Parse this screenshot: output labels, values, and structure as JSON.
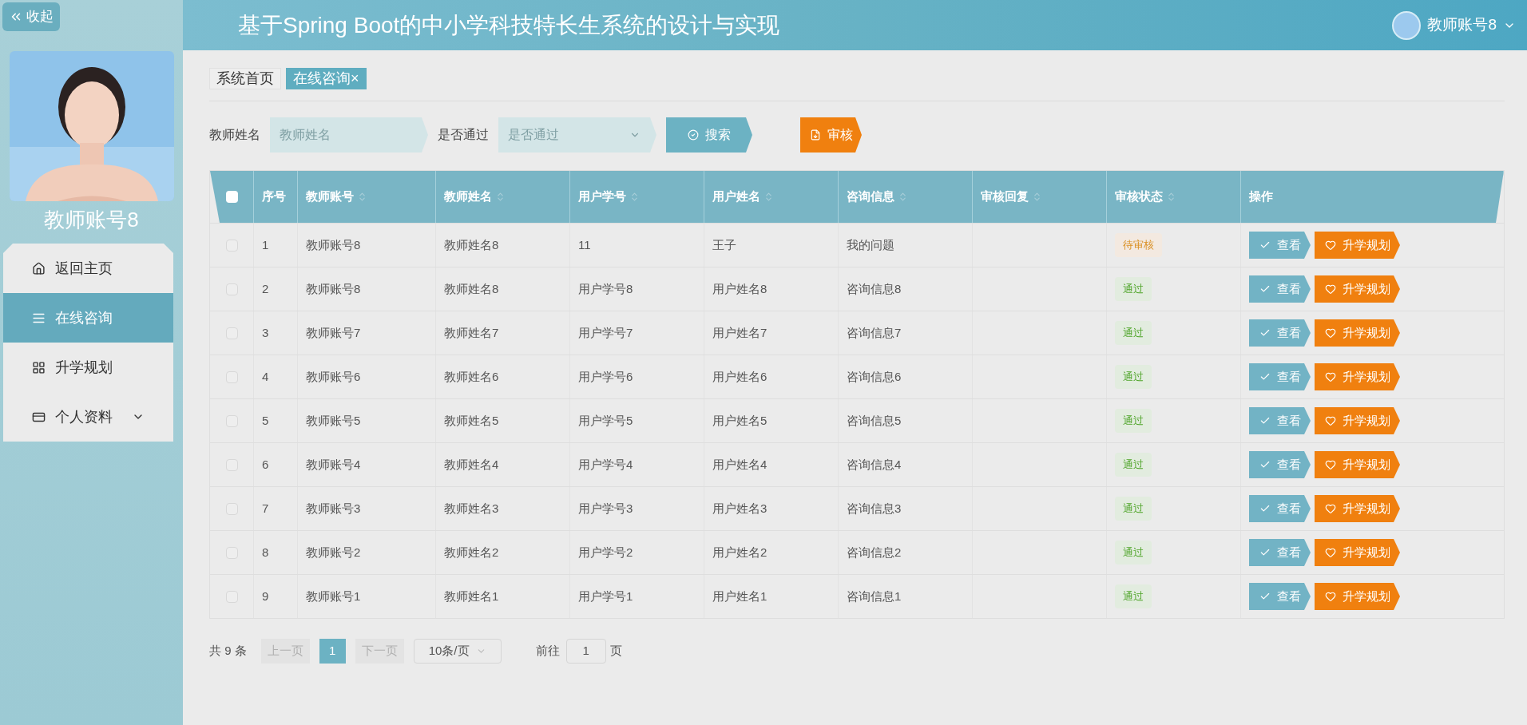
{
  "sidebar": {
    "collapse_button": "收起",
    "profile_name": "教师账号8",
    "items": [
      {
        "label": "返回主页",
        "selected": false,
        "kind": "link"
      },
      {
        "label": "在线咨询",
        "selected": true,
        "kind": "link"
      },
      {
        "label": "升学规划",
        "selected": false,
        "kind": "link"
      },
      {
        "label": "个人资料",
        "selected": false,
        "kind": "submenu"
      }
    ]
  },
  "header": {
    "title": "基于Spring Boot的中小学科技特长生系统的设计与实现",
    "user": "教师账号8"
  },
  "tabs": [
    {
      "label": "系统首页",
      "selected": false
    },
    {
      "label": "在线咨询",
      "selected": true,
      "close": "×"
    }
  ],
  "filters": {
    "fields": [
      {
        "label": "教师姓名",
        "placeholder": "教师姓名",
        "kind": "text"
      },
      {
        "label": "是否通过",
        "placeholder": "是否通过",
        "kind": "select"
      }
    ],
    "search_button": "搜索",
    "review_button": "审核"
  },
  "table": {
    "header_checked": false,
    "columns": [
      {
        "label": "序号",
        "kind": "plain"
      },
      {
        "label": "教师账号",
        "kind": "sortable"
      },
      {
        "label": "教师姓名",
        "kind": "sortable"
      },
      {
        "label": "用户学号",
        "kind": "sortable"
      },
      {
        "label": "用户姓名",
        "kind": "sortable"
      },
      {
        "label": "咨询信息",
        "kind": "sortable"
      },
      {
        "label": "审核回复",
        "kind": "sortable"
      },
      {
        "label": "审核状态",
        "kind": "sortable"
      },
      {
        "label": "操作",
        "kind": "plain"
      }
    ],
    "rows": [
      {
        "checked": false,
        "cells": [
          "1",
          "教师账号8",
          "教师姓名8",
          "11",
          "王子",
          "我的问题"
        ],
        "status": "待审核",
        "pending": true,
        "actions": [
          "查看",
          "升学规划"
        ]
      },
      {
        "checked": false,
        "cells": [
          "2",
          "教师账号8",
          "教师姓名8",
          "用户学号8",
          "用户姓名8",
          "咨询信息8"
        ],
        "status": "通过",
        "pending": false,
        "actions": [
          "查看",
          "升学规划"
        ]
      },
      {
        "checked": false,
        "cells": [
          "3",
          "教师账号7",
          "教师姓名7",
          "用户学号7",
          "用户姓名7",
          "咨询信息7"
        ],
        "status": "通过",
        "pending": false,
        "actions": [
          "查看",
          "升学规划"
        ]
      },
      {
        "checked": false,
        "cells": [
          "4",
          "教师账号6",
          "教师姓名6",
          "用户学号6",
          "用户姓名6",
          "咨询信息6"
        ],
        "status": "通过",
        "pending": false,
        "actions": [
          "查看",
          "升学规划"
        ]
      },
      {
        "checked": false,
        "cells": [
          "5",
          "教师账号5",
          "教师姓名5",
          "用户学号5",
          "用户姓名5",
          "咨询信息5"
        ],
        "status": "通过",
        "pending": false,
        "actions": [
          "查看",
          "升学规划"
        ]
      },
      {
        "checked": false,
        "cells": [
          "6",
          "教师账号4",
          "教师姓名4",
          "用户学号4",
          "用户姓名4",
          "咨询信息4"
        ],
        "status": "通过",
        "pending": false,
        "actions": [
          "查看",
          "升学规划"
        ]
      },
      {
        "checked": false,
        "cells": [
          "7",
          "教师账号3",
          "教师姓名3",
          "用户学号3",
          "用户姓名3",
          "咨询信息3"
        ],
        "status": "通过",
        "pending": false,
        "actions": [
          "查看",
          "升学规划"
        ]
      },
      {
        "checked": false,
        "cells": [
          "8",
          "教师账号2",
          "教师姓名2",
          "用户学号2",
          "用户姓名2",
          "咨询信息2"
        ],
        "status": "通过",
        "pending": false,
        "actions": [
          "查看",
          "升学规划"
        ]
      },
      {
        "checked": false,
        "cells": [
          "9",
          "教师账号1",
          "教师姓名1",
          "用户学号1",
          "用户姓名1",
          "咨询信息1"
        ],
        "status": "通过",
        "pending": false,
        "actions": [
          "查看",
          "升学规划"
        ]
      }
    ]
  },
  "pagination": {
    "total": "共 9 条",
    "prev": "上一页",
    "pages": [
      {
        "label": "1",
        "selected": true
      }
    ],
    "next": "下一页",
    "page_size": "10条/页",
    "goto_label": "前往",
    "goto_value": "1",
    "goto_suffix": "页"
  }
}
